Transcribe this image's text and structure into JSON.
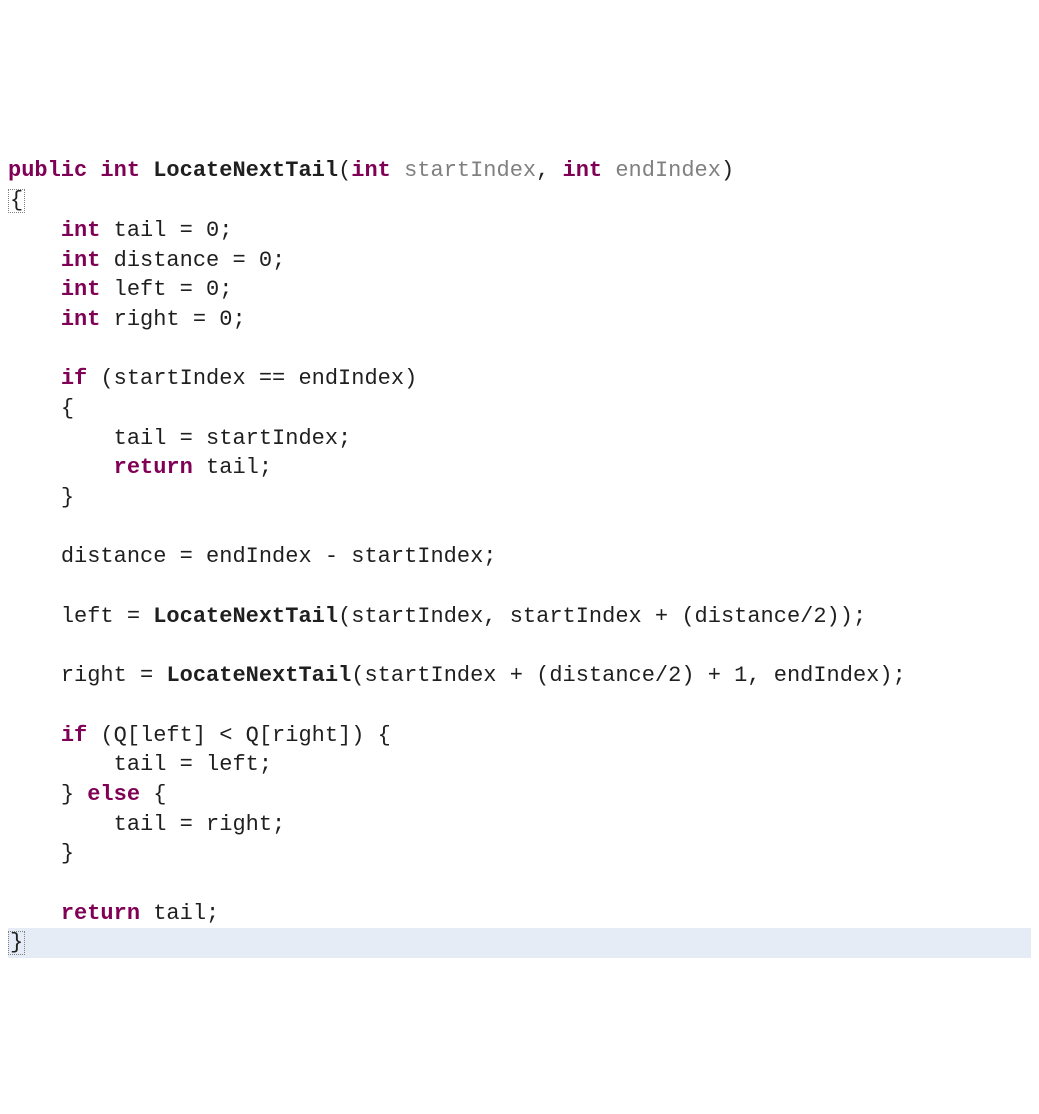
{
  "code": {
    "sig_public": "public",
    "sig_int": "int",
    "sig_method": "LocateNextTail",
    "sig_open": "(",
    "sig_p1_type": "int",
    "sig_p1_name": "startIndex",
    "sig_comma": ", ",
    "sig_p2_type": "int",
    "sig_p2_name": "endIndex",
    "sig_close": ")",
    "open_brace": "{",
    "decl_int": "int",
    "decl_tail": "tail = 0;",
    "decl_distance": "distance = 0;",
    "decl_left": "left = 0;",
    "decl_right": "right = 0;",
    "if_kw": "if",
    "if_cond": " (startIndex == endIndex)",
    "if_open": "{",
    "if_body1": "tail = startIndex;",
    "return_kw": "return",
    "if_body2": " tail;",
    "if_close": "}",
    "dist_line": "distance = endIndex - startIndex;",
    "left_assign_pre": "left = ",
    "left_call": "LocateNextTail",
    "left_args": "(startIndex, startIndex + (distance/2));",
    "right_assign_pre": "right = ",
    "right_call": "LocateNextTail",
    "right_args": "(startIndex + (distance/2) + 1, endIndex);",
    "if2_kw": "if",
    "if2_cond": " (Q[left] < Q[right]) {",
    "if2_body": "tail = left;",
    "else_close_open": "} ",
    "else_kw": "else",
    "else_open": " {",
    "else_body": "tail = right;",
    "block_close": "}",
    "final_return_kw": "return",
    "final_return_expr": " tail;",
    "close_brace": "}"
  }
}
